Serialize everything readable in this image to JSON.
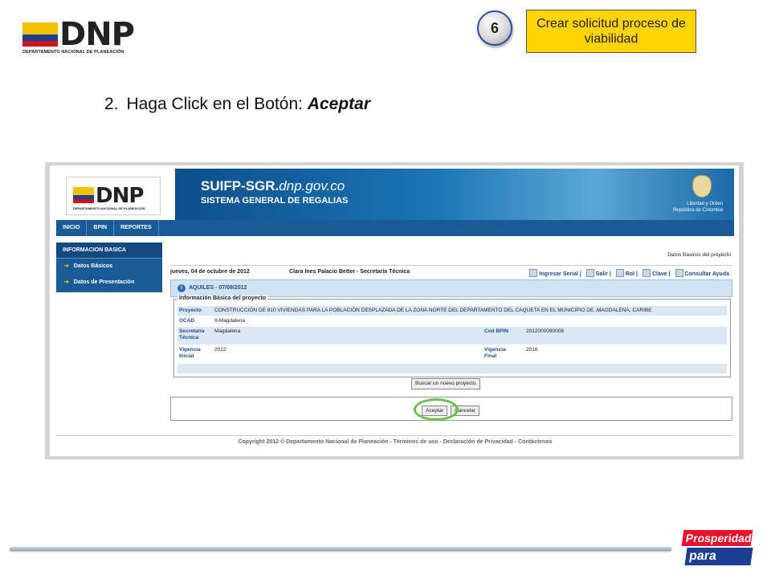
{
  "header": {
    "logo_word": "DNP",
    "logo_sub": "DEPARTAMENTO NACIONAL DE PLANEACIÓN",
    "step_number": "6",
    "title": "Crear solicitud proceso de viabilidad"
  },
  "instruction": {
    "number": "2.",
    "text": "Haga Click en el Botón: ",
    "emphasis": "Aceptar"
  },
  "app": {
    "logo_word": "DNP",
    "logo_sub": "DEPARTAMENTO NACIONAL DE PLANEACIÓN",
    "banner_title": "SUIFP-SGR.",
    "banner_domain": "dnp.gov.co",
    "banner_subtitle": "SISTEMA GENERAL DE REGALIAS",
    "republica_line1": "Libertad y Orden",
    "republica_line2": "República de Colombia",
    "nav": [
      "INICIO",
      "BPIN",
      "REPORTES"
    ],
    "sidebar": {
      "header": "INFORMACION BASICA",
      "items": [
        "Datos Básicos",
        "Datos de Presentación"
      ]
    },
    "breadcrumb": "Datos Basicos del proyecto",
    "date": "jueves, 04 de octubre de 2012",
    "user": "Clara Ines Palacio Better - Secretaría Técnica",
    "links": [
      "Ingresar Serial",
      "Salir",
      "Rol",
      "Clave",
      "Consultar Ayuda"
    ],
    "project_bar": "AQUILES - 07/09/2012",
    "legend": "Información Básica del proyecto",
    "fields": {
      "proyecto_label": "Proyecto",
      "proyecto_value": "CONSTRUCCIÓN DE 810 VIVIENDAS PARA LA POBLACIÓN DESPLAZADA DE LA ZONA NORTE DEL DEPARTAMENTO DEL CAQUETA EN EL MUNICIPIO DE ,MAGDALENA, CARIBE",
      "ocad_label": "OCAD",
      "ocad_value": "9-Magdalena",
      "secretaria_label": "Secretaría Técnica",
      "secretaria_value": "Magdalena",
      "codbpin_label": "Cod BPIN",
      "codbpin_value": "2012000090008",
      "vig_ini_label": "Vigencia Inicial",
      "vig_ini_value": "2012",
      "vig_fin_label": "Vigencia Final",
      "vig_fin_value": "2016"
    },
    "buscar_button": "Buscar un nuevo proyecto",
    "accept_button": "Aceptar",
    "cancel_button": "Cancelar",
    "footer": "Copyright 2012 © Departamento Nacional de Planeación - Términos de uso - Declaración de Privacidad - Contáctenos"
  },
  "branding": {
    "line1": "Prosperidad",
    "line2": "para todos"
  },
  "colors": {
    "title_box": "#ffd400",
    "highlight_ring": "#6cc04a",
    "nav_blue": "#1a5a96"
  }
}
